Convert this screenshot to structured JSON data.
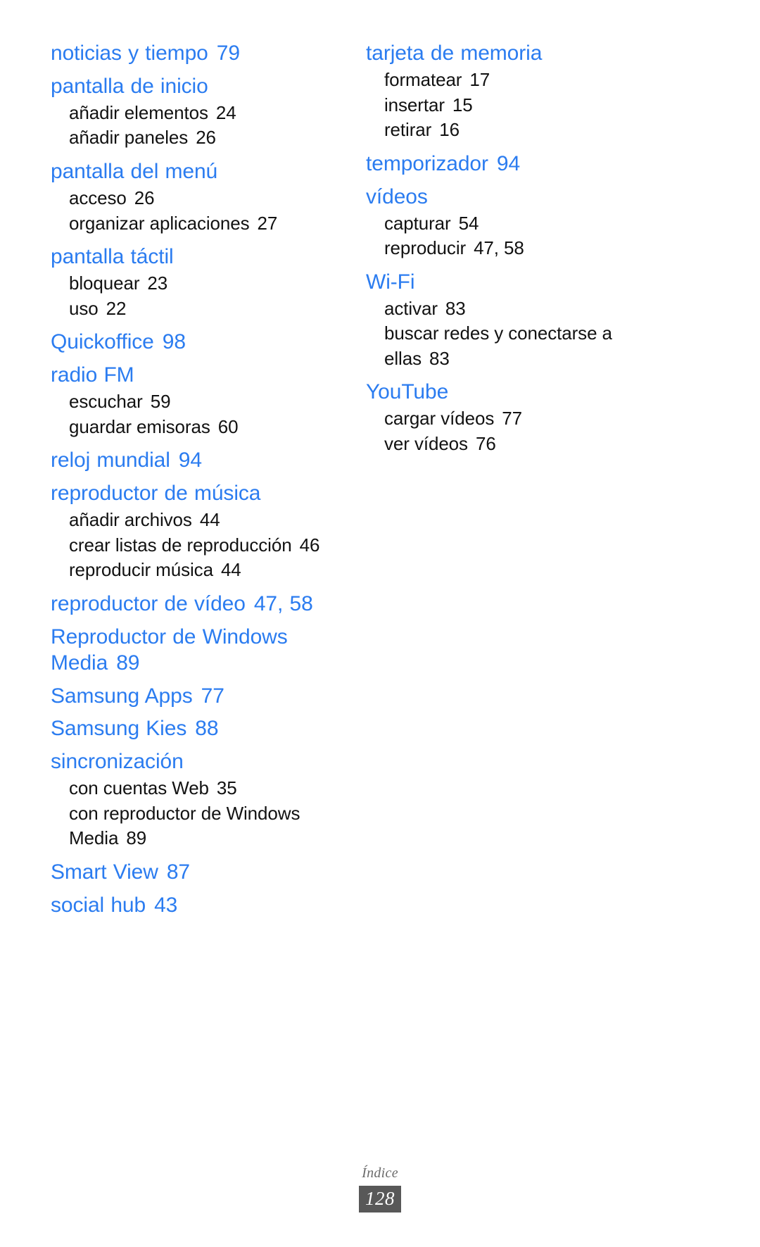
{
  "document": {
    "type": "index-page",
    "language": "es",
    "footer_label": "Índice",
    "page_number": "128",
    "accent_color": "#2b7cf0",
    "text_color": "#121212",
    "footer_badge_color": "#585858"
  },
  "columns": [
    {
      "id": "left",
      "entries": [
        {
          "term": "noticias y tiempo",
          "pages": "79",
          "subentries": []
        },
        {
          "term": "pantalla de inicio",
          "pages": "",
          "subentries": [
            {
              "term": "añadir elementos",
              "pages": "24"
            },
            {
              "term": "añadir paneles",
              "pages": "26"
            }
          ]
        },
        {
          "term": "pantalla del menú",
          "pages": "",
          "subentries": [
            {
              "term": "acceso",
              "pages": "26"
            },
            {
              "term": "organizar aplicaciones",
              "pages": "27"
            }
          ]
        },
        {
          "term": "pantalla táctil",
          "pages": "",
          "subentries": [
            {
              "term": "bloquear",
              "pages": "23"
            },
            {
              "term": "uso",
              "pages": "22"
            }
          ]
        },
        {
          "term": "Quickoffice",
          "pages": "98",
          "subentries": []
        },
        {
          "term": "radio FM",
          "pages": "",
          "subentries": [
            {
              "term": "escuchar",
              "pages": "59"
            },
            {
              "term": "guardar emisoras",
              "pages": "60"
            }
          ]
        },
        {
          "term": "reloj mundial",
          "pages": "94",
          "subentries": []
        },
        {
          "term": "reproductor de música",
          "pages": "",
          "subentries": [
            {
              "term": "añadir archivos",
              "pages": "44"
            },
            {
              "term": "crear listas de reproducción",
              "pages": "46"
            },
            {
              "term": "reproducir música",
              "pages": "44"
            }
          ]
        },
        {
          "term": "reproductor de vídeo",
          "pages": "47, 58",
          "subentries": []
        },
        {
          "term": "Reproductor de Windows Media",
          "pages": "89",
          "subentries": []
        },
        {
          "term": "Samsung Apps",
          "pages": "77",
          "subentries": []
        },
        {
          "term": "Samsung Kies",
          "pages": "88",
          "subentries": []
        },
        {
          "term": "sincronización",
          "pages": "",
          "subentries": [
            {
              "term": "con cuentas Web",
              "pages": "35"
            },
            {
              "term": "con reproductor de Windows Media",
              "pages": "89"
            }
          ]
        },
        {
          "term": "Smart View",
          "pages": "87",
          "subentries": []
        },
        {
          "term": "social hub",
          "pages": "43",
          "subentries": []
        }
      ]
    },
    {
      "id": "right",
      "entries": [
        {
          "term": "tarjeta de memoria",
          "pages": "",
          "subentries": [
            {
              "term": "formatear",
              "pages": "17"
            },
            {
              "term": "insertar",
              "pages": "15"
            },
            {
              "term": "retirar",
              "pages": "16"
            }
          ]
        },
        {
          "term": "temporizador",
          "pages": "94",
          "subentries": []
        },
        {
          "term": "vídeos",
          "pages": "",
          "subentries": [
            {
              "term": "capturar",
              "pages": "54"
            },
            {
              "term": "reproducir",
              "pages": "47, 58"
            }
          ]
        },
        {
          "term": "Wi-Fi",
          "pages": "",
          "subentries": [
            {
              "term": "activar",
              "pages": "83"
            },
            {
              "term": "buscar redes y conectarse a ellas",
              "pages": "83"
            }
          ]
        },
        {
          "term": "YouTube",
          "pages": "",
          "subentries": [
            {
              "term": "cargar vídeos",
              "pages": "77"
            },
            {
              "term": "ver vídeos",
              "pages": "76"
            }
          ]
        }
      ]
    }
  ]
}
